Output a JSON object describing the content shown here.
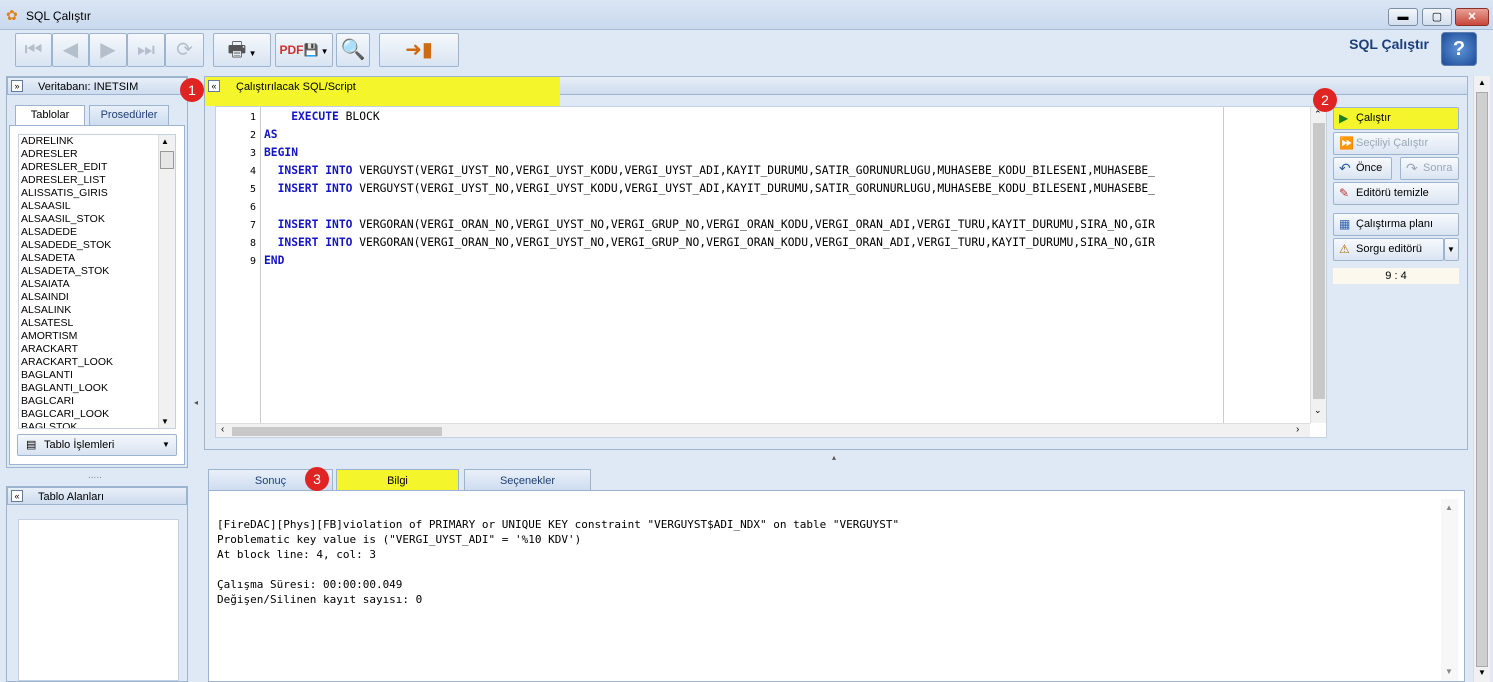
{
  "window": {
    "title": "SQL Çalıştır",
    "minimize": "▬",
    "maximize": "▢",
    "close": "✕"
  },
  "toolbar": {
    "page_title": "SQL Çalıştır",
    "help": "?",
    "buttons": [
      "first-record-icon",
      "prev-record-icon",
      "next-record-icon",
      "last-record-icon",
      "refresh-icon",
      "printer-icon",
      "pdf-save-icon",
      "find-icon",
      "exit-icon"
    ]
  },
  "left_panel": {
    "database_label": "Veritabanı: INETSIM",
    "tabs": [
      "Tablolar",
      "Prosedürler"
    ],
    "tables": [
      "ADRELINK",
      "ADRESLER",
      "ADRESLER_EDIT",
      "ADRESLER_LIST",
      "ALISSATIS_GIRIS",
      "ALSAASIL",
      "ALSAASIL_STOK",
      "ALSADEDE",
      "ALSADEDE_STOK",
      "ALSADETA",
      "ALSADETA_STOK",
      "ALSAIATA",
      "ALSAINDI",
      "ALSALINK",
      "ALSATESL",
      "AMORTISM",
      "ARACKART",
      "ARACKART_LOOK",
      "BAGLANTI",
      "BAGLANTI_LOOK",
      "BAGLCARI",
      "BAGLCARI_LOOK",
      "BAGLSTOK"
    ],
    "table_ops": "Tablo İşlemleri",
    "fields_label": "Tablo Alanları",
    "splitter_dots": "....."
  },
  "editor": {
    "header": "Çalıştırılacak SQL/Script",
    "lines": [
      {
        "n": "1",
        "kw1": "    EXECUTE",
        "rest": " BLOCK"
      },
      {
        "n": "2",
        "kw1": "AS",
        "rest": ""
      },
      {
        "n": "3",
        "kw1": "BEGIN",
        "rest": ""
      },
      {
        "n": "4",
        "kw1": "  INSERT INTO",
        "rest": " VERGUYST(VERGI_UYST_NO,VERGI_UYST_KODU,VERGI_UYST_ADI,KAYIT_DURUMU,SATIR_GORUNURLUGU,MUHASEBE_KODU_BILESENI,MUHASEBE_"
      },
      {
        "n": "5",
        "kw1": "  INSERT INTO",
        "rest": " VERGUYST(VERGI_UYST_NO,VERGI_UYST_KODU,VERGI_UYST_ADI,KAYIT_DURUMU,SATIR_GORUNURLUGU,MUHASEBE_KODU_BILESENI,MUHASEBE_"
      },
      {
        "n": "6",
        "kw1": "",
        "rest": ""
      },
      {
        "n": "7",
        "kw1": "  INSERT INTO",
        "rest": " VERGORAN(VERGI_ORAN_NO,VERGI_UYST_NO,VERGI_GRUP_NO,VERGI_ORAN_KODU,VERGI_ORAN_ADI,VERGI_TURU,KAYIT_DURUMU,SIRA_NO,GIR"
      },
      {
        "n": "8",
        "kw1": "  INSERT INTO",
        "rest": " VERGORAN(VERGI_ORAN_NO,VERGI_UYST_NO,VERGI_GRUP_NO,VERGI_ORAN_KODU,VERGI_ORAN_ADI,VERGI_TURU,KAYIT_DURUMU,SIRA_NO,GIR"
      },
      {
        "n": "9",
        "kw1": "END",
        "rest": ""
      }
    ]
  },
  "actions": {
    "run": "Çalıştır",
    "run_selected": "Seçiliyi Çalıştır",
    "prev": "Önce",
    "next": "Sonra",
    "clear_editor": "Editörü temizle",
    "exec_plan": "Çalıştırma planı",
    "query_editor": "Sorgu editörü",
    "cursor_pos": "9 : 4"
  },
  "bottom": {
    "tabs": [
      "Sonuç",
      "Bilgi",
      "Seçenekler"
    ],
    "output": [
      "[FireDAC][Phys][FB]violation of PRIMARY or UNIQUE KEY constraint \"VERGUYST$ADI_NDX\" on table \"VERGUYST\"",
      "Problematic key value is (\"VERGI_UYST_ADI\" = '%10 KDV')",
      "At block line: 4, col: 3",
      "",
      "Çalışma Süresi: 00:00:00.049",
      "Değişen/Silinen kayıt sayısı: 0"
    ]
  },
  "markers": [
    "1",
    "2",
    "3"
  ],
  "colors": {
    "highlight": "#f4f62b",
    "marker": "#e02424",
    "keyword": "#1515c8"
  }
}
